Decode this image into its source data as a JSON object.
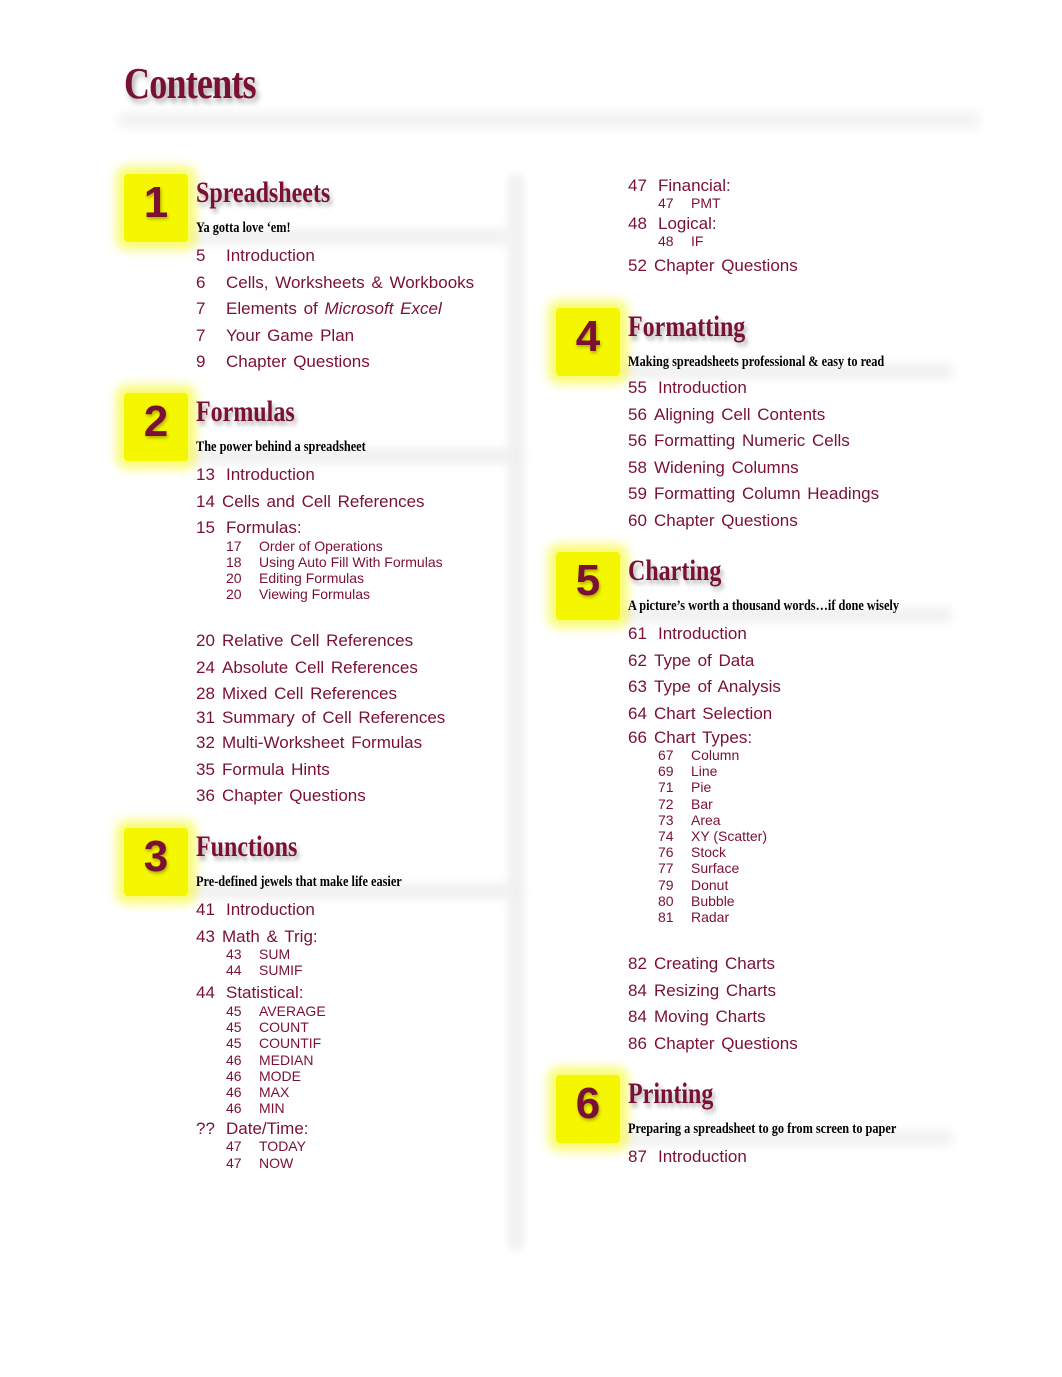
{
  "title": "Contents",
  "chapters": [
    {
      "number": "1",
      "title": "Spreadsheets",
      "subtitle": "Ya gotta love ‘em!",
      "entries": [
        {
          "page": "5",
          "label": "Introduction"
        },
        {
          "page": "6",
          "label": "Cells, Worksheets & Workbooks"
        },
        {
          "page": "7",
          "label_prefix": "Elements of ",
          "label_italic": "Microsoft Excel"
        },
        {
          "page": "7",
          "label": "Your Game Plan"
        },
        {
          "page": "9",
          "label": "Chapter Questions"
        }
      ]
    },
    {
      "number": "2",
      "title": "Formulas",
      "subtitle": "The power behind a spreadsheet",
      "entries": [
        {
          "page": "13",
          "label": "Introduction"
        },
        {
          "page": "14",
          "label": "Cells and Cell References"
        },
        {
          "page": "15",
          "label": "Formulas:",
          "subentries": [
            {
              "page": "17",
              "label": "Order of Operations"
            },
            {
              "page": "18",
              "label": "Using Auto Fill With Formulas"
            },
            {
              "page": "20",
              "label": "Editing Formulas"
            },
            {
              "page": "20",
              "label": "Viewing Formulas"
            }
          ]
        },
        {
          "page": "20",
          "label": "Relative Cell References"
        },
        {
          "page": "24",
          "label": "Absolute Cell References"
        },
        {
          "page": "28",
          "label": "Mixed Cell References"
        },
        {
          "page": "31",
          "label": "Summary of Cell References"
        },
        {
          "page": "32",
          "label": "Multi-Worksheet Formulas"
        },
        {
          "page": "35",
          "label": "Formula Hints"
        },
        {
          "page": "36",
          "label": "Chapter Questions"
        }
      ]
    },
    {
      "number": "3",
      "title": "Functions",
      "subtitle": "Pre-defined jewels that make life easier",
      "entries": [
        {
          "page": "41",
          "label": "Introduction"
        },
        {
          "page": "43",
          "label": "Math & Trig:",
          "subentries": [
            {
              "page": "43",
              "label": "SUM"
            },
            {
              "page": "44",
              "label": "SUMIF"
            }
          ]
        },
        {
          "page": "44",
          "label": "Statistical:",
          "subentries": [
            {
              "page": "45",
              "label": "AVERAGE"
            },
            {
              "page": "45",
              "label": "COUNT"
            },
            {
              "page": "45",
              "label": "COUNTIF"
            },
            {
              "page": "46",
              "label": "MEDIAN"
            },
            {
              "page": "46",
              "label": "MODE"
            },
            {
              "page": "46",
              "label": "MAX"
            },
            {
              "page": "46",
              "label": "MIN"
            }
          ]
        },
        {
          "page": "??",
          "label": "Date/Time:",
          "subentries": [
            {
              "page": "47",
              "label": "TODAY"
            },
            {
              "page": "47",
              "label": "NOW"
            }
          ]
        },
        {
          "page": "47",
          "label": "Financial:",
          "subentries": [
            {
              "page": "47",
              "label": "PMT"
            }
          ]
        },
        {
          "page": "48",
          "label": "Logical:",
          "subentries": [
            {
              "page": "48",
              "label": "IF"
            }
          ]
        },
        {
          "page": "52",
          "label": "Chapter Questions"
        }
      ]
    },
    {
      "number": "4",
      "title": "Formatting",
      "subtitle": "Making spreadsheets professional & easy to read",
      "entries": [
        {
          "page": "55",
          "label": "Introduction"
        },
        {
          "page": "56",
          "label": "Aligning Cell Contents"
        },
        {
          "page": "56",
          "label": "Formatting Numeric Cells"
        },
        {
          "page": "58",
          "label": "Widening Columns"
        },
        {
          "page": "59",
          "label": "Formatting Column Headings"
        },
        {
          "page": "60",
          "label": "Chapter Questions"
        }
      ]
    },
    {
      "number": "5",
      "title": "Charting",
      "subtitle": "A picture’s worth a thousand words…if done wisely",
      "entries": [
        {
          "page": "61",
          "label": "Introduction"
        },
        {
          "page": "62",
          "label": "Type of Data"
        },
        {
          "page": "63",
          "label": "Type of Analysis"
        },
        {
          "page": "64",
          "label": "Chart Selection"
        },
        {
          "page": "66",
          "label": "Chart Types:",
          "subentries": [
            {
              "page": "67",
              "label": "Column"
            },
            {
              "page": "69",
              "label": "Line"
            },
            {
              "page": "71",
              "label": "Pie"
            },
            {
              "page": "72",
              "label": "Bar"
            },
            {
              "page": "73",
              "label": "Area"
            },
            {
              "page": "74",
              "label": "XY (Scatter)"
            },
            {
              "page": "76",
              "label": "Stock"
            },
            {
              "page": "77",
              "label": "Surface"
            },
            {
              "page": "79",
              "label": "Donut"
            },
            {
              "page": "80",
              "label": "Bubble"
            },
            {
              "page": "81",
              "label": "Radar"
            }
          ]
        },
        {
          "page": "82",
          "label": "Creating Charts"
        },
        {
          "page": "84",
          "label": "Resizing Charts"
        },
        {
          "page": "84",
          "label": "Moving Charts"
        },
        {
          "page": "86",
          "label": "Chapter Questions"
        }
      ]
    },
    {
      "number": "6",
      "title": "Printing",
      "subtitle": "Preparing a spreadsheet to go from screen to paper",
      "entries": [
        {
          "page": "87",
          "label": "Introduction"
        }
      ]
    }
  ]
}
